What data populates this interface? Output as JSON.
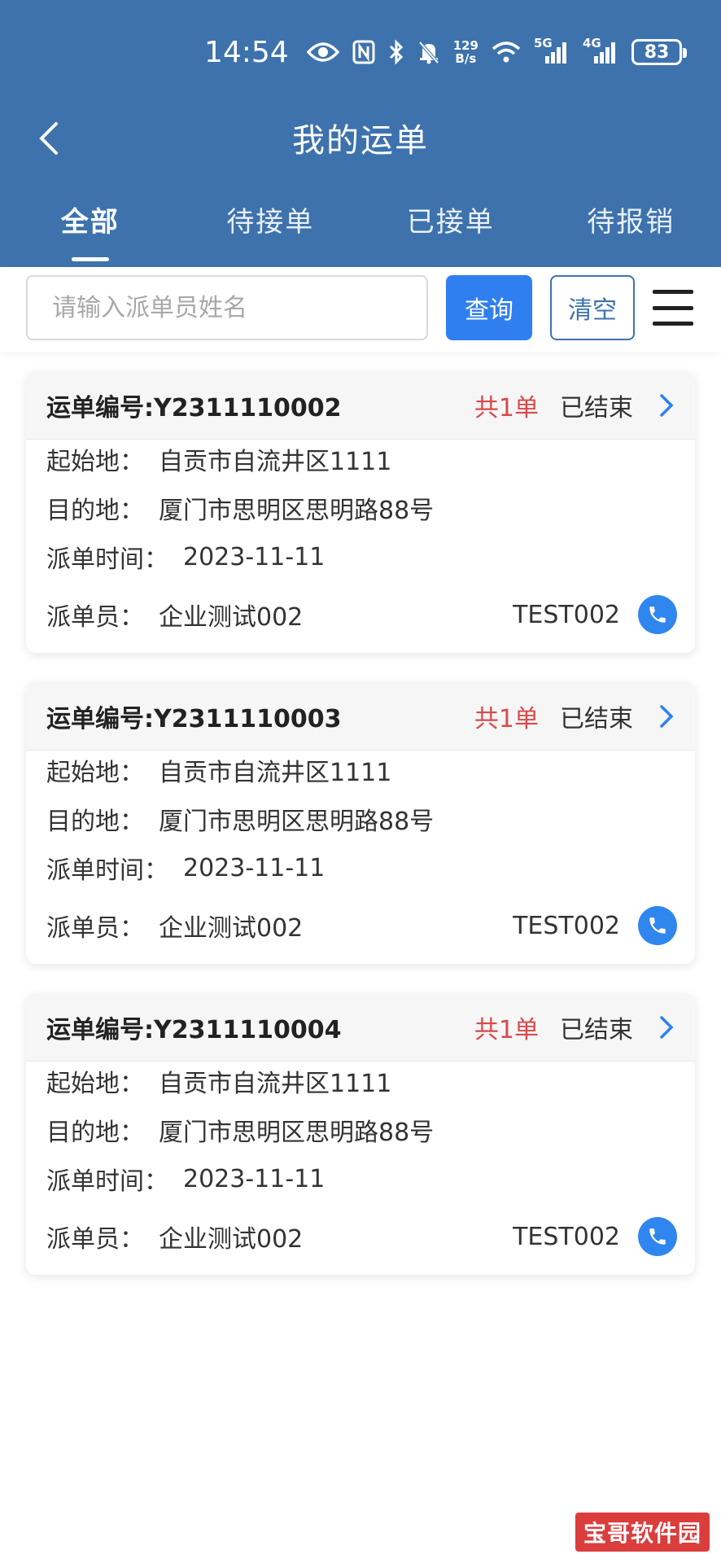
{
  "status_bar": {
    "time": "14:54",
    "net_speed_value": "129",
    "net_speed_unit": "B/s",
    "signal_5g": "5G",
    "signal_4g": "4G",
    "battery": "83"
  },
  "header": {
    "title": "我的运单",
    "tabs": [
      {
        "label": "全部",
        "active": true
      },
      {
        "label": "待接单",
        "active": false
      },
      {
        "label": "已接单",
        "active": false
      },
      {
        "label": "待报销",
        "active": false
      }
    ]
  },
  "search": {
    "placeholder": "请输入派单员姓名",
    "value": "",
    "query_label": "查询",
    "clear_label": "清空"
  },
  "labels": {
    "origin": "起始地：",
    "destination": "目的地：",
    "dispatch_time": "派单时间：",
    "dispatcher": "派单员："
  },
  "orders": [
    {
      "order_no": "运单编号:Y2311110002",
      "count": "共1单",
      "status": "已结束",
      "origin": "自贡市自流井区1111",
      "destination": "厦门市思明区思明路88号",
      "dispatch_time": "2023-11-11",
      "dispatcher": "企业测试002",
      "dispatcher_code": "TEST002"
    },
    {
      "order_no": "运单编号:Y2311110003",
      "count": "共1单",
      "status": "已结束",
      "origin": "自贡市自流井区1111",
      "destination": "厦门市思明区思明路88号",
      "dispatch_time": "2023-11-11",
      "dispatcher": "企业测试002",
      "dispatcher_code": "TEST002"
    },
    {
      "order_no": "运单编号:Y2311110004",
      "count": "共1单",
      "status": "已结束",
      "origin": "自贡市自流井区1111",
      "destination": "厦门市思明区思明路88号",
      "dispatch_time": "2023-11-11",
      "dispatcher": "企业测试002",
      "dispatcher_code": "TEST002"
    }
  ],
  "watermark": "宝哥软件园",
  "colors": {
    "header_bg": "#3d72ad",
    "primary_button": "#2f7ff0",
    "count_red": "#d84a4a",
    "phone_blue": "#2f86ef"
  }
}
